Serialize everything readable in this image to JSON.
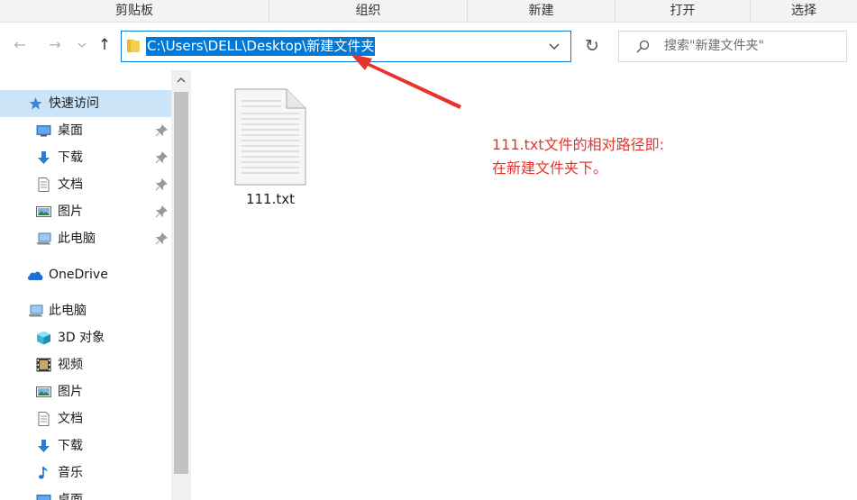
{
  "ribbon": {
    "groups": [
      {
        "label": "剪贴板"
      },
      {
        "label": "组织"
      },
      {
        "label": "新建"
      },
      {
        "label": "打开"
      },
      {
        "label": "选择"
      }
    ]
  },
  "address": {
    "path": "C:\\Users\\DELL\\Desktop\\新建文件夹",
    "icon": "folder-icon"
  },
  "search": {
    "placeholder": "搜索\"新建文件夹\"",
    "icon": "search-icon"
  },
  "nav": {
    "items": [
      {
        "label": "快速访问",
        "icon": "star-icon"
      },
      {
        "label": "桌面",
        "icon": "desktop-icon"
      },
      {
        "label": "下载",
        "icon": "download-icon"
      },
      {
        "label": "文档",
        "icon": "document-icon"
      },
      {
        "label": "图片",
        "icon": "pictures-icon"
      },
      {
        "label": "此电脑",
        "icon": "computer-icon"
      },
      {
        "label": "OneDrive",
        "icon": "cloud-icon"
      },
      {
        "label": "此电脑",
        "icon": "computer-icon"
      },
      {
        "label": "3D 对象",
        "icon": "cube-icon"
      },
      {
        "label": "视频",
        "icon": "video-icon"
      },
      {
        "label": "图片",
        "icon": "pictures-icon"
      },
      {
        "label": "文档",
        "icon": "document-icon"
      },
      {
        "label": "下载",
        "icon": "download-icon"
      },
      {
        "label": "音乐",
        "icon": "music-icon"
      },
      {
        "label": "桌面",
        "icon": "desktop-icon"
      }
    ]
  },
  "files": [
    {
      "name": "111.txt",
      "icon": "text-file-icon"
    }
  ],
  "annotation": {
    "line1": "111.txt文件的相对路径即:",
    "line2": "在新建文件夹下。",
    "color": "#e8322c"
  },
  "colors": {
    "accent": "#0078d7",
    "selection": "#cce4f7"
  }
}
